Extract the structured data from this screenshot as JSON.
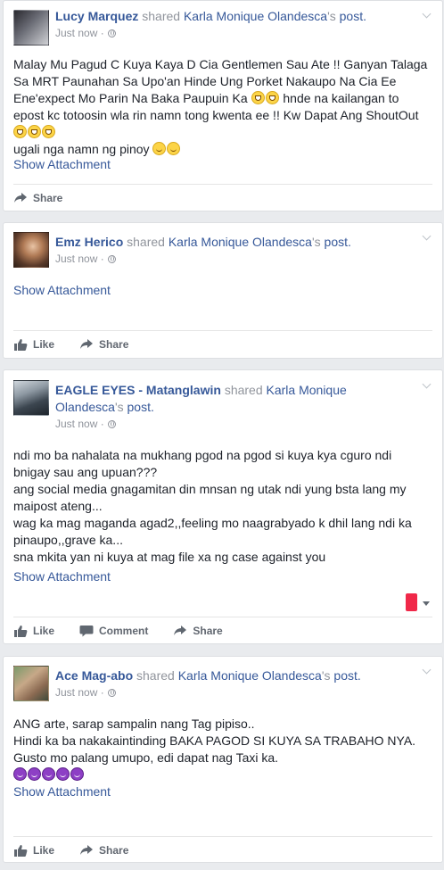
{
  "posts": [
    {
      "actor": "Lucy Marquez",
      "shared_word": "shared",
      "source": "Karla Monique Olandesca",
      "poss": "'s",
      "post_word": "post.",
      "time": "Just now",
      "body": [
        "Malay Mu Pagud C Kuya Kaya D Cia Gentlemen Sau Ate !! Ganyan Talaga",
        "Sa MRT Paunahan Sa Upo'an Hinde Ung Porket Nakaupo Na Cia Ee",
        "Ene'expect Mo Parin Na Baka Paupuin Ka",
        "hnde na kailangan to",
        "epost kc totoosin wla rin namn tong kwenta ee !! Kw Dapat Ang ShoutOut",
        "ugali nga namn ng pinoy"
      ],
      "attachment": "Show Attachment",
      "actions": [
        "Share"
      ]
    },
    {
      "actor": "Emz Herico",
      "shared_word": "shared",
      "source": "Karla Monique Olandesca",
      "poss": "'s",
      "post_word": "post.",
      "time": "Just now",
      "attachment": "Show Attachment",
      "actions": [
        "Like",
        "Share"
      ]
    },
    {
      "actor": "EAGLE EYES - Matanglawin",
      "shared_word": "shared",
      "source": "Karla Monique",
      "source2": "Olandesca",
      "poss": "'s",
      "post_word": "post.",
      "time": "Just now",
      "body": [
        "ndi mo ba nahalata na mukhang pgod na pgod si kuya kya cguro ndi",
        "bnigay sau ang upuan???",
        "ang social media gnagamitan din mnsan ng utak ndi yung bsta lang my",
        "maipost ateng...",
        "wag ka mag maganda agad2,,feeling mo naagrabyado k dhil lang ndi ka",
        "pinaupo,,grave ka...",
        "sna mkita yan ni kuya at mag file xa ng case against you"
      ],
      "attachment": "Show Attachment",
      "actions": [
        "Like",
        "Comment",
        "Share"
      ]
    },
    {
      "actor": "Ace Mag-abo",
      "shared_word": "shared",
      "source": "Karla Monique Olandesca",
      "poss": "'s",
      "post_word": "post.",
      "time": "Just now",
      "body": [
        "ANG arte, sarap sampalin nang Tag pipiso..",
        "Hindi ka ba nakakaintinding BAKA PAGOD SI KUYA SA TRABAHO NYA.",
        "Gusto mo palang umupo, edi dapat nag Taxi ka."
      ],
      "attachment": "Show Attachment",
      "actions": [
        "Like",
        "Share"
      ]
    }
  ],
  "icons": {
    "like": "thumbs-up-icon",
    "share": "share-arrow-icon",
    "comment": "comment-bubble-icon",
    "privacy": "globe-icon",
    "menu": "chevron-down-icon"
  },
  "colors": {
    "link": "#365899",
    "meta": "#90949c",
    "action": "#616770",
    "flag": "#f02849"
  }
}
